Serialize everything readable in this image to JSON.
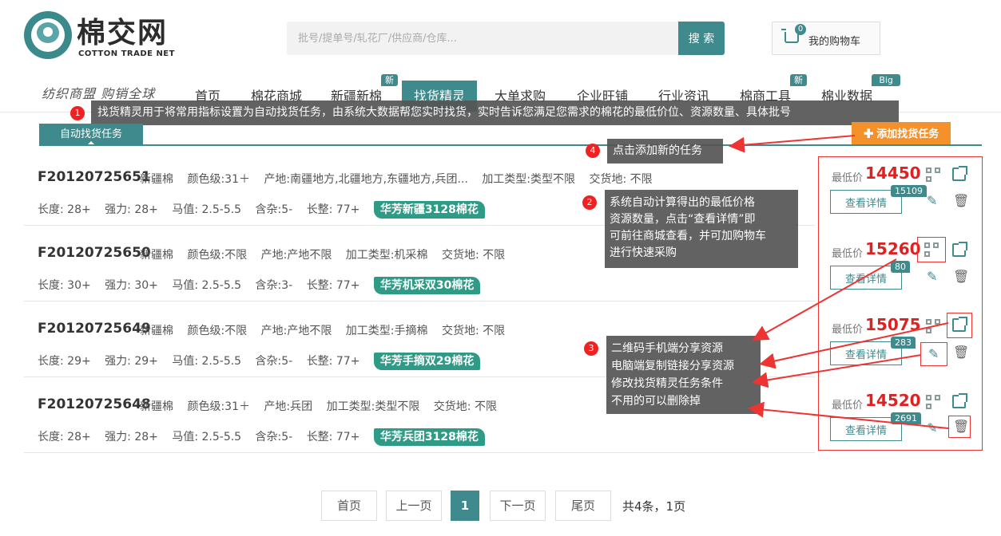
{
  "logo": {
    "main": "棉交网",
    "sub": "COTTON TRADE NET"
  },
  "search": {
    "placeholder": "批号/提单号/轧花厂/供应商/仓库...",
    "button": "搜 索"
  },
  "cart": {
    "label": "我的购物车",
    "count": "0"
  },
  "slogan": "纺织商盟  购销全球",
  "nav": [
    {
      "label": "首页",
      "badge": ""
    },
    {
      "label": "棉花商城",
      "badge": ""
    },
    {
      "label": "新疆新棉",
      "badge": "新"
    },
    {
      "label": "找货精灵",
      "badge": ""
    },
    {
      "label": "大单求购",
      "badge": ""
    },
    {
      "label": "企业旺铺",
      "badge": ""
    },
    {
      "label": "行业资讯",
      "badge": ""
    },
    {
      "label": "棉商工具",
      "badge": "新"
    },
    {
      "label": "棉业数据",
      "badge": "Big Data"
    }
  ],
  "tips": {
    "t1": {
      "num": "1",
      "text": "找货精灵用于将常用指标设置为自动找货任务，由系统大数据帮您实时找货，实时告诉您满足您需求的棉花的最低价位、资源数量、具体批号"
    },
    "t2": {
      "num": "2",
      "lines": [
        "系统自动计算得出的最低价格",
        "资源数量，点击“查看详情”即",
        "可前往商城查看，并可加购物车",
        "进行快速采购"
      ]
    },
    "t3": {
      "num": "3",
      "lines": [
        "二维码手机端分享资源",
        "电脑端复制链接分享资源",
        "修改找货精灵任务条件",
        "不用的可以删除掉"
      ]
    },
    "t4": {
      "num": "4",
      "text": "点击添加新的任务"
    }
  },
  "tabs": {
    "auto": "自动找货任务",
    "add": "✚ 添加找货任务"
  },
  "rows": [
    {
      "code": "F20120725651",
      "kind": "新疆棉",
      "grade": "颜色级:31＋",
      "origin": "产地:南疆地方,北疆地方,东疆地方,兵团...",
      "process": "加工类型:类型不限",
      "delivery": "交货地: 不限",
      "length": "长度: 28+",
      "strength": "强力: 28+",
      "mic": "马值: 2.5-5.5",
      "trash": "含杂:5-",
      "uniform": "长整: 77+",
      "tag": "华芳新疆3128棉花",
      "price_label": "最低价",
      "price": "14450",
      "detail": "查看详情",
      "count": "15109"
    },
    {
      "code": "F20120725650",
      "kind": "新疆棉",
      "grade": "颜色级:不限",
      "origin": "产地:产地不限",
      "process": "加工类型:机采棉",
      "delivery": "交货地: 不限",
      "length": "长度: 30+",
      "strength": "强力: 30+",
      "mic": "马值: 2.5-5.5",
      "trash": "含杂:3-",
      "uniform": "长整: 77+",
      "tag": "华芳机采双30棉花",
      "price_label": "最低价",
      "price": "15260",
      "detail": "查看详情",
      "count": "80"
    },
    {
      "code": "F20120725649",
      "kind": "新疆棉",
      "grade": "颜色级:不限",
      "origin": "产地:产地不限",
      "process": "加工类型:手摘棉",
      "delivery": "交货地: 不限",
      "length": "长度: 29+",
      "strength": "强力: 29+",
      "mic": "马值: 2.5-5.5",
      "trash": "含杂:5-",
      "uniform": "长整: 77+",
      "tag": "华芳手摘双29棉花",
      "price_label": "最低价",
      "price": "15075",
      "detail": "查看详情",
      "count": "283"
    },
    {
      "code": "F20120725648",
      "kind": "新疆棉",
      "grade": "颜色级:31＋",
      "origin": "产地:兵团",
      "process": "加工类型:类型不限",
      "delivery": "交货地: 不限",
      "length": "长度: 28+",
      "strength": "强力: 28+",
      "mic": "马值: 2.5-5.5",
      "trash": "含杂:5-",
      "uniform": "长整: 77+",
      "tag": "华芳兵团3128棉花",
      "price_label": "最低价",
      "price": "14520",
      "detail": "查看详情",
      "count": "2691"
    }
  ],
  "pagination": {
    "first": "首页",
    "prev": "上一页",
    "current": "1",
    "next": "下一页",
    "last": "尾页",
    "total": "共4条，1页"
  },
  "colors": {
    "brand": "#3f8a8d",
    "price": "#d22222",
    "highlight": "#ee3333",
    "accent": "#f5912b"
  }
}
